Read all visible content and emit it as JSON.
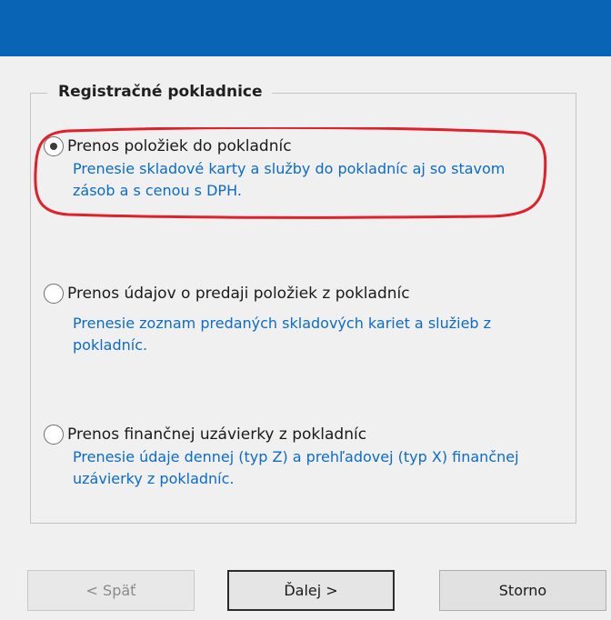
{
  "group": {
    "title": "Registračné pokladnice"
  },
  "options": [
    {
      "label": "Prenos položiek do pokladníc",
      "description": "Prenesie skladové karty a služby do pokladníc aj so stavom zásob a s cenou s DPH.",
      "selected": true
    },
    {
      "label": "Prenos údajov o predaji položiek z pokladníc",
      "description": "Prenesie zoznam predaných skladových kariet a služieb z pokladníc.",
      "selected": false
    },
    {
      "label": "Prenos finančnej uzávierky z pokladníc",
      "description": "Prenesie údaje dennej (typ Z) a prehľadovej (typ X) finančnej uzávierky z pokladníc.",
      "selected": false
    }
  ],
  "buttons": {
    "back": "< Späť",
    "next": "Ďalej >",
    "cancel": "Storno"
  },
  "colors": {
    "title_bar": "#0a64b6",
    "description_text": "#0b6cc9",
    "highlight_annotation": "#e0202a"
  }
}
